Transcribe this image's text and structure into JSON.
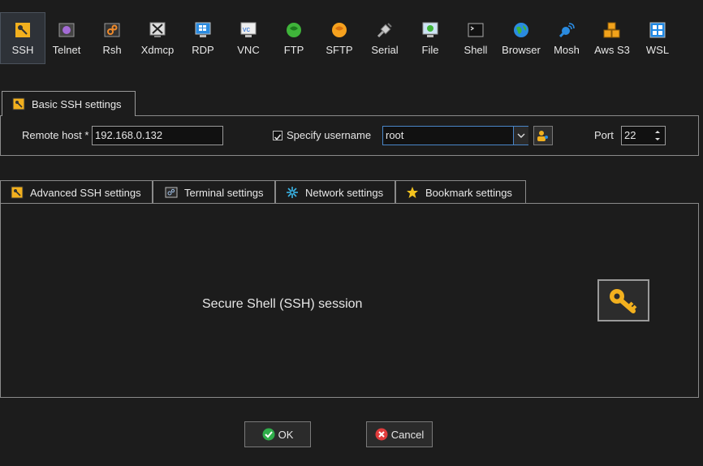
{
  "toolbar": {
    "items": [
      {
        "label": "SSH",
        "icon": "key-icon"
      },
      {
        "label": "Telnet",
        "icon": "telnet-icon"
      },
      {
        "label": "Rsh",
        "icon": "rsh-icon"
      },
      {
        "label": "Xdmcp",
        "icon": "xdmcp-icon"
      },
      {
        "label": "RDP",
        "icon": "rdp-icon"
      },
      {
        "label": "VNC",
        "icon": "vnc-icon"
      },
      {
        "label": "FTP",
        "icon": "ftp-icon"
      },
      {
        "label": "SFTP",
        "icon": "sftp-icon"
      },
      {
        "label": "Serial",
        "icon": "serial-icon"
      },
      {
        "label": "File",
        "icon": "file-icon"
      },
      {
        "label": "Shell",
        "icon": "shell-icon"
      },
      {
        "label": "Browser",
        "icon": "browser-icon"
      },
      {
        "label": "Mosh",
        "icon": "mosh-icon"
      },
      {
        "label": "Aws S3",
        "icon": "aws-s3-icon"
      },
      {
        "label": "WSL",
        "icon": "wsl-icon"
      }
    ],
    "active": "SSH"
  },
  "basic": {
    "tab_label": "Basic SSH settings",
    "remote_host_label": "Remote host *",
    "remote_host_value": "192.168.0.132",
    "specify_username_label": "Specify username",
    "specify_username_checked": true,
    "username_value": "root",
    "port_label": "Port",
    "port_value": "22"
  },
  "tabs": [
    {
      "label": "Advanced SSH settings"
    },
    {
      "label": "Terminal settings"
    },
    {
      "label": "Network settings"
    },
    {
      "label": "Bookmark settings"
    }
  ],
  "session": {
    "description": "Secure Shell (SSH) session"
  },
  "buttons": {
    "ok": "OK",
    "cancel": "Cancel"
  },
  "colors": {
    "background": "#1c1c1c",
    "accent": "#f2b01e",
    "ok_green": "#2fae4a",
    "cancel_red": "#e03c3c"
  }
}
